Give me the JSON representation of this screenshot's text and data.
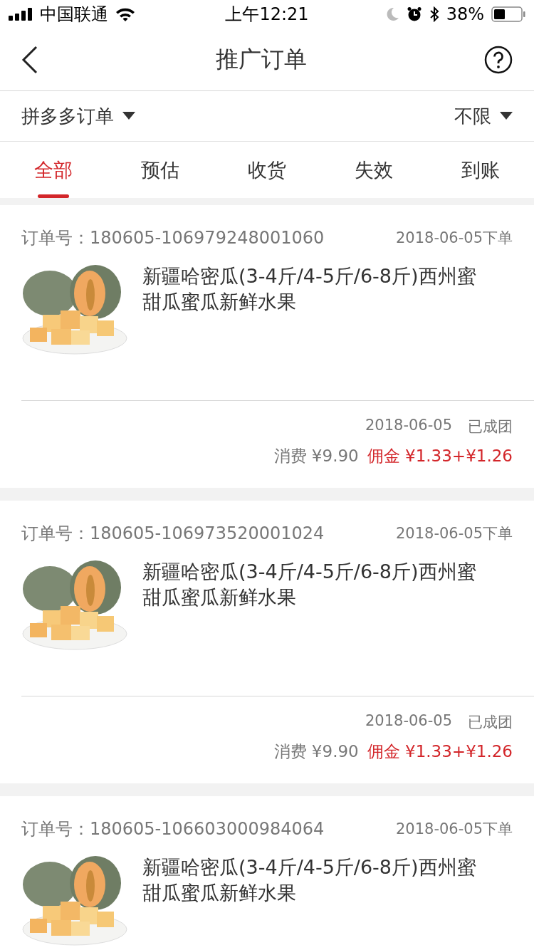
{
  "status_bar": {
    "carrier": "中国联通",
    "time": "上午12:21",
    "battery": "38%"
  },
  "nav": {
    "title": "推广订单"
  },
  "filters": [
    {
      "label": "拼多多订单"
    },
    {
      "label": "不限"
    }
  ],
  "tabs": [
    {
      "label": "全部",
      "selected": true
    },
    {
      "label": "预估",
      "selected": false
    },
    {
      "label": "收货",
      "selected": false
    },
    {
      "label": "失效",
      "selected": false
    },
    {
      "label": "到账",
      "selected": false
    }
  ],
  "orders": [
    {
      "order_label": "订单号：",
      "order_no": "180605-106979248001060",
      "placed": "2018-06-05下单",
      "title": "新疆哈密瓜(3-4斤/4-5斤/6-8斤)西州蜜甜瓜蜜瓜新鲜水果",
      "date": "2018-06-05",
      "status": "已成团",
      "spend": "消费 ¥9.90",
      "commission": "佣金 ¥1.33+¥1.26"
    },
    {
      "order_label": "订单号：",
      "order_no": "180605-106973520001024",
      "placed": "2018-06-05下单",
      "title": "新疆哈密瓜(3-4斤/4-5斤/6-8斤)西州蜜甜瓜蜜瓜新鲜水果",
      "date": "2018-06-05",
      "status": "已成团",
      "spend": "消费 ¥9.90",
      "commission": "佣金 ¥1.33+¥1.26"
    },
    {
      "order_label": "订单号：",
      "order_no": "180605-106603000984064",
      "placed": "2018-06-05下单",
      "title": "新疆哈密瓜(3-4斤/4-5斤/6-8斤)西州蜜甜瓜蜜瓜新鲜水果"
    }
  ]
}
